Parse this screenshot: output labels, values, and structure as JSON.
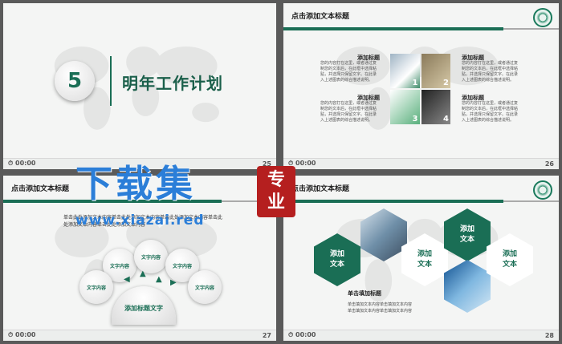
{
  "slides": {
    "s1": {
      "number": "5",
      "title": "明年工作计划",
      "time": "00:00",
      "page": "25"
    },
    "s2": {
      "header": "点击添加文本标题",
      "features": [
        {
          "title": "添加标题",
          "text": "您的内容打在这里，或者通过复制您的文本后，在此框中选择粘贴，并选择只保留文字。在此录入上述图表的综合描述说明。"
        },
        {
          "title": "添加标题",
          "text": "您的内容打在这里，或者通过复制您的文本后，在此框中选择粘贴，并选择只保留文字。在此录入上述图表的综合描述说明。"
        },
        {
          "title": "添加标题",
          "text": "您的内容打在这里，或者通过复制您的文本后，在此框中选择粘贴，并选择只保留文字。在此录入上述图表的综合描述说明。"
        },
        {
          "title": "添加标题",
          "text": "您的内容打在这里，或者通过复制您的文本后，在此框中选择粘贴，并选择只保留文字。在此录入上述图表的综合描述说明。"
        }
      ],
      "grid_numbers": [
        "1",
        "2",
        "3",
        "4"
      ],
      "time": "00:00",
      "page": "26"
    },
    "s3": {
      "header": "点击添加文本标题",
      "text": "单击此处添加文本内容单击此处添加文本内容单击此处添加文本内容单击此处添加文本内容单击此处添加文本内容",
      "bubbles": [
        "文字内容",
        "文字内容",
        "文字内容",
        "文字内容",
        "文字内容"
      ],
      "hub": "添加标题文字",
      "time": "00:00",
      "page": "27"
    },
    "s4": {
      "header": "点击添加文本标题",
      "hexes": [
        {
          "line1": "添加",
          "line2": "文本"
        },
        {
          "line1": "添加",
          "line2": "文本"
        },
        {
          "line1": "添加",
          "line2": "文本"
        },
        {
          "line1": "添加",
          "line2": "文本"
        }
      ],
      "subtitle": "单击填加标题",
      "text1": "单击填加文本内容单击填加文本内容",
      "text2": "单击填加文本内容单击填加文本内容",
      "time": "00:00",
      "page": "28"
    }
  },
  "watermark": {
    "title": "下载集",
    "seal1": "专",
    "seal2": "业",
    "url": "www.xiazai.red"
  },
  "colors": {
    "accent": "#1a6e55",
    "watermark": "#2b7ed8",
    "seal": "#b51f1f"
  }
}
